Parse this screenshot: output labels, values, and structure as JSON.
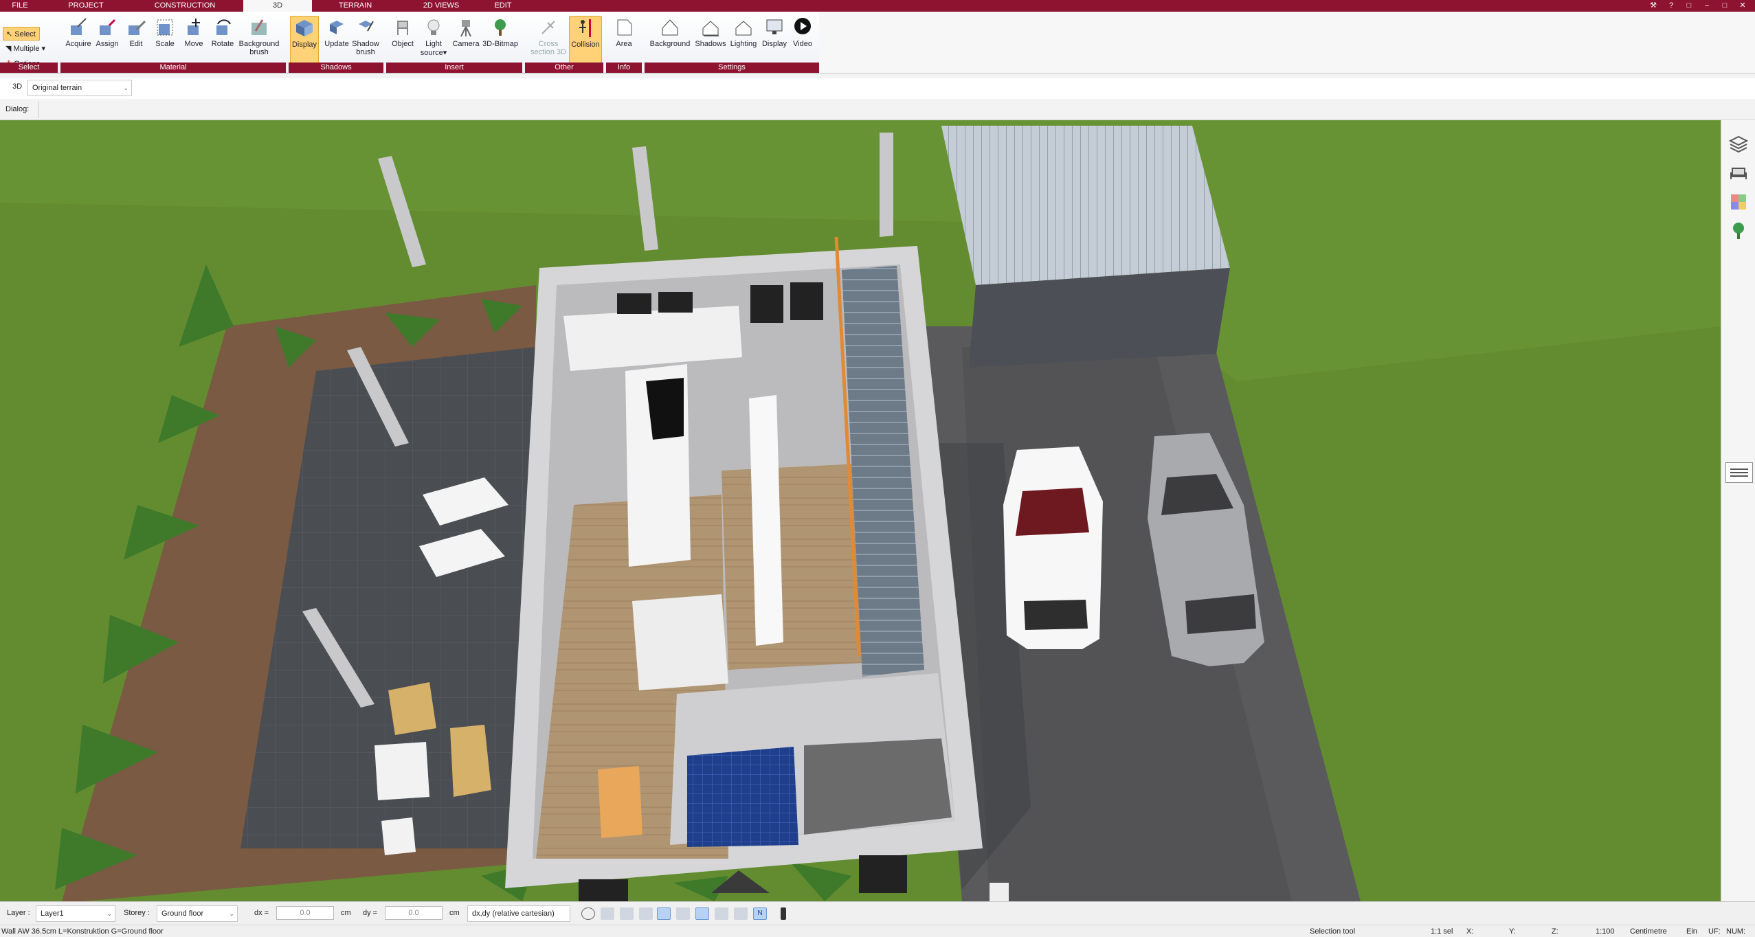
{
  "tabs": [
    {
      "label": "FILE"
    },
    {
      "label": "PROJECT"
    },
    {
      "label": "CONSTRUCTION"
    },
    {
      "label": "3D"
    },
    {
      "label": "TERRAIN"
    },
    {
      "label": "2D VIEWS"
    },
    {
      "label": "EDIT"
    }
  ],
  "select_group": {
    "select": "Select",
    "multiple": "Multiple",
    "options": "Options",
    "label": "Select"
  },
  "ribbon": {
    "material": {
      "label": "Material",
      "acquire": "Acquire",
      "assign": "Assign",
      "edit": "Edit",
      "scale": "Scale",
      "move": "Move",
      "rotate": "Rotate",
      "background_brush_1": "Background",
      "background_brush_2": "brush"
    },
    "shadows": {
      "label": "Shadows",
      "display": "Display",
      "update": "Update",
      "shadow_brush_1": "Shadow",
      "shadow_brush_2": "brush"
    },
    "insert": {
      "label": "Insert",
      "object": "Object",
      "light_1": "Light",
      "light_2": "source",
      "camera": "Camera",
      "bitmap": "3D-Bitmap"
    },
    "other": {
      "label": "Other",
      "cross_1": "Cross",
      "cross_2": "section 3D",
      "collision": "Collision"
    },
    "info": {
      "label": "Info",
      "area": "Area"
    },
    "settings": {
      "label": "Settings",
      "background": "Background",
      "shadows": "Shadows",
      "lighting": "Lighting",
      "display": "Display",
      "video": "Video"
    }
  },
  "subbar": {
    "mode": "3D",
    "terrain": "Original terrain"
  },
  "dialog_label": "Dialog:",
  "bottom": {
    "layer_label": "Layer :",
    "layer_value": "Layer1",
    "storey_label": "Storey :",
    "storey_value": "Ground floor",
    "dx_label": "dx =",
    "dx_value": "0.0",
    "dx_unit": "cm",
    "dy_label": "dy =",
    "dy_value": "0.0",
    "dy_unit": "cm",
    "coord_mode": "dx,dy (relative cartesian)"
  },
  "status": {
    "info": "Wall AW 36.5cm L=Konstruktion G=Ground floor",
    "tool": "Selection tool",
    "scale_sel": "1:1 sel",
    "x": "X:",
    "y": "Y:",
    "z": "Z:",
    "scale": "1:100",
    "unit": "Centimetre",
    "ein": "Ein",
    "uf": "UF:",
    "num": "NUM:"
  },
  "colors": {
    "brand": "#8d1330",
    "active": "#ffd277",
    "grass": "#5f8d2c",
    "pavement": "#505050",
    "wall": "#d3d3d5"
  }
}
